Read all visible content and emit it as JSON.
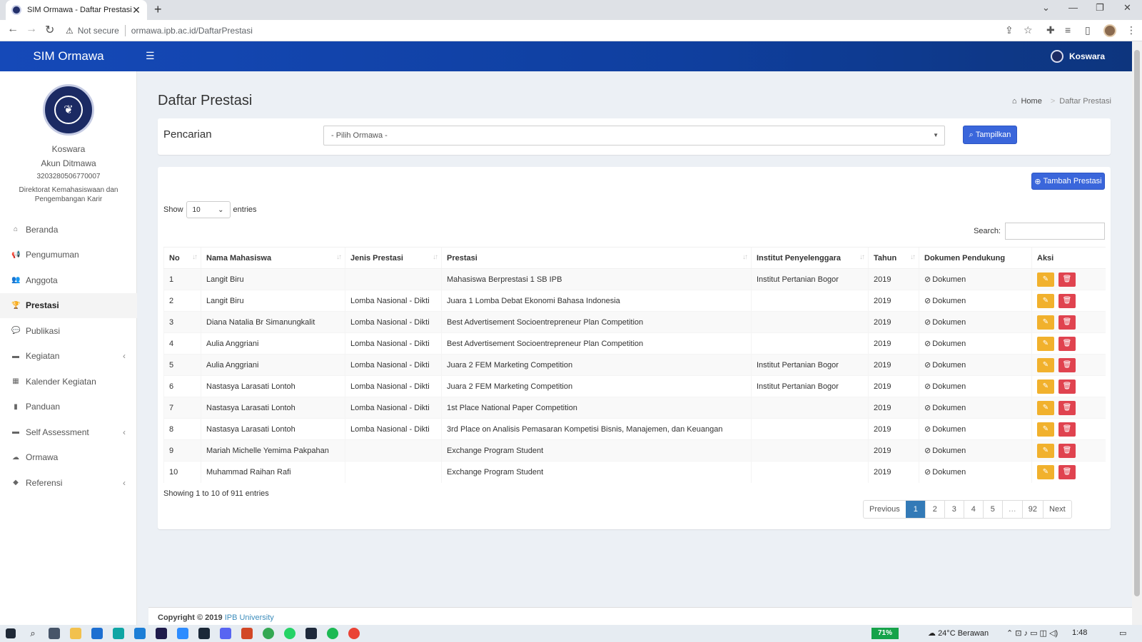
{
  "browser": {
    "tab_title": "SIM Ormawa - Daftar Prestasi",
    "security_label": "Not secure",
    "url": "ormawa.ipb.ac.id/DaftarPrestasi"
  },
  "header": {
    "brand": "SIM Ormawa",
    "user": "Koswara"
  },
  "profile": {
    "name": "Koswara",
    "role": "Akun Ditmawa",
    "id": "3203280506770007",
    "unit": "Direktorat Kemahasiswaan dan Pengembangan Karir"
  },
  "sidebar": {
    "items": [
      {
        "label": "Beranda",
        "icon": "home-icon",
        "glyph": "⌂"
      },
      {
        "label": "Pengumuman",
        "icon": "bullhorn-icon",
        "glyph": "📢"
      },
      {
        "label": "Anggota",
        "icon": "users-icon",
        "glyph": "👥"
      },
      {
        "label": "Prestasi",
        "icon": "trophy-icon",
        "glyph": "🏆"
      },
      {
        "label": "Publikasi",
        "icon": "comments-icon",
        "glyph": "💬"
      },
      {
        "label": "Kegiatan",
        "icon": "folder-icon",
        "glyph": "▬"
      },
      {
        "label": "Kalender Kegiatan",
        "icon": "calendar-icon",
        "glyph": "▦"
      },
      {
        "label": "Panduan",
        "icon": "book-icon",
        "glyph": "▮"
      },
      {
        "label": "Self Assessment",
        "icon": "folder-icon",
        "glyph": "▬"
      },
      {
        "label": "Ormawa",
        "icon": "cloud-icon",
        "glyph": "☁"
      },
      {
        "label": "Referensi",
        "icon": "tags-icon",
        "glyph": "◆"
      }
    ]
  },
  "page": {
    "title": "Daftar Prestasi",
    "breadcrumb_home": "Home",
    "breadcrumb_current": "Daftar Prestasi"
  },
  "search": {
    "label": "Pencarian",
    "select_value": "- Pilih Ormawa -",
    "button": "Tampilkan"
  },
  "table": {
    "add_button": "Tambah Prestasi",
    "show_label": "Show",
    "entries_label": "entries",
    "page_length": "10",
    "search_label": "Search:",
    "columns": [
      "No",
      "Nama Mahasiswa",
      "Jenis Prestasi",
      "Prestasi",
      "Institut Penyelenggara",
      "Tahun",
      "Dokumen Pendukung",
      "Aksi"
    ],
    "rows": [
      {
        "no": "1",
        "nama": "Langit Biru",
        "jenis": "",
        "prestasi": "Mahasiswa Berprestasi 1 SB IPB",
        "institut": "Institut Pertanian Bogor",
        "tahun": "2019",
        "dokumen": "Dokumen"
      },
      {
        "no": "2",
        "nama": "Langit Biru",
        "jenis": "Lomba Nasional - Dikti",
        "prestasi": "Juara 1 Lomba Debat Ekonomi Bahasa Indonesia",
        "institut": "",
        "tahun": "2019",
        "dokumen": "Dokumen"
      },
      {
        "no": "3",
        "nama": "Diana Natalia Br Simanungkalit",
        "jenis": "Lomba Nasional - Dikti",
        "prestasi": "Best Advertisement Socioentrepreneur Plan Competition",
        "institut": "",
        "tahun": "2019",
        "dokumen": "Dokumen"
      },
      {
        "no": "4",
        "nama": "Aulia Anggriani",
        "jenis": "Lomba Nasional - Dikti",
        "prestasi": "Best Advertisement Socioentrepreneur Plan Competition",
        "institut": "",
        "tahun": "2019",
        "dokumen": "Dokumen"
      },
      {
        "no": "5",
        "nama": "Aulia Anggriani",
        "jenis": "Lomba Nasional - Dikti",
        "prestasi": "Juara 2 FEM Marketing Competition",
        "institut": "Institut Pertanian Bogor",
        "tahun": "2019",
        "dokumen": "Dokumen"
      },
      {
        "no": "6",
        "nama": "Nastasya Larasati Lontoh",
        "jenis": "Lomba Nasional - Dikti",
        "prestasi": "Juara 2 FEM Marketing Competition",
        "institut": "Institut Pertanian Bogor",
        "tahun": "2019",
        "dokumen": "Dokumen"
      },
      {
        "no": "7",
        "nama": "Nastasya Larasati Lontoh",
        "jenis": "Lomba Nasional - Dikti",
        "prestasi": "1st Place National Paper Competition",
        "institut": "",
        "tahun": "2019",
        "dokumen": "Dokumen"
      },
      {
        "no": "8",
        "nama": "Nastasya Larasati Lontoh",
        "jenis": "Lomba Nasional - Dikti",
        "prestasi": "3rd Place on Analisis Pemasaran Kompetisi Bisnis, Manajemen, dan Keuangan",
        "institut": "",
        "tahun": "2019",
        "dokumen": "Dokumen"
      },
      {
        "no": "9",
        "nama": "Mariah Michelle Yemima Pakpahan",
        "jenis": "",
        "prestasi": "Exchange Program Student",
        "institut": "",
        "tahun": "2019",
        "dokumen": "Dokumen"
      },
      {
        "no": "10",
        "nama": "Muhammad Raihan Rafi",
        "jenis": "",
        "prestasi": "Exchange Program Student",
        "institut": "",
        "tahun": "2019",
        "dokumen": "Dokumen"
      }
    ],
    "info": "Showing 1 to 10 of 911 entries",
    "pagination": [
      "Previous",
      "1",
      "2",
      "3",
      "4",
      "5",
      "…",
      "92",
      "Next"
    ],
    "active_page": "1"
  },
  "footer": {
    "copyright": "Copyright © 2019",
    "link": "IPB University"
  },
  "taskbar": {
    "battery": "71%",
    "weather": "24°C  Berawan",
    "time": "1:48"
  },
  "colors": {
    "header": "#1549b8",
    "primary_button": "#3a66db",
    "edit": "#f1b12d",
    "delete": "#e0434f",
    "page_active": "#337ab7"
  }
}
